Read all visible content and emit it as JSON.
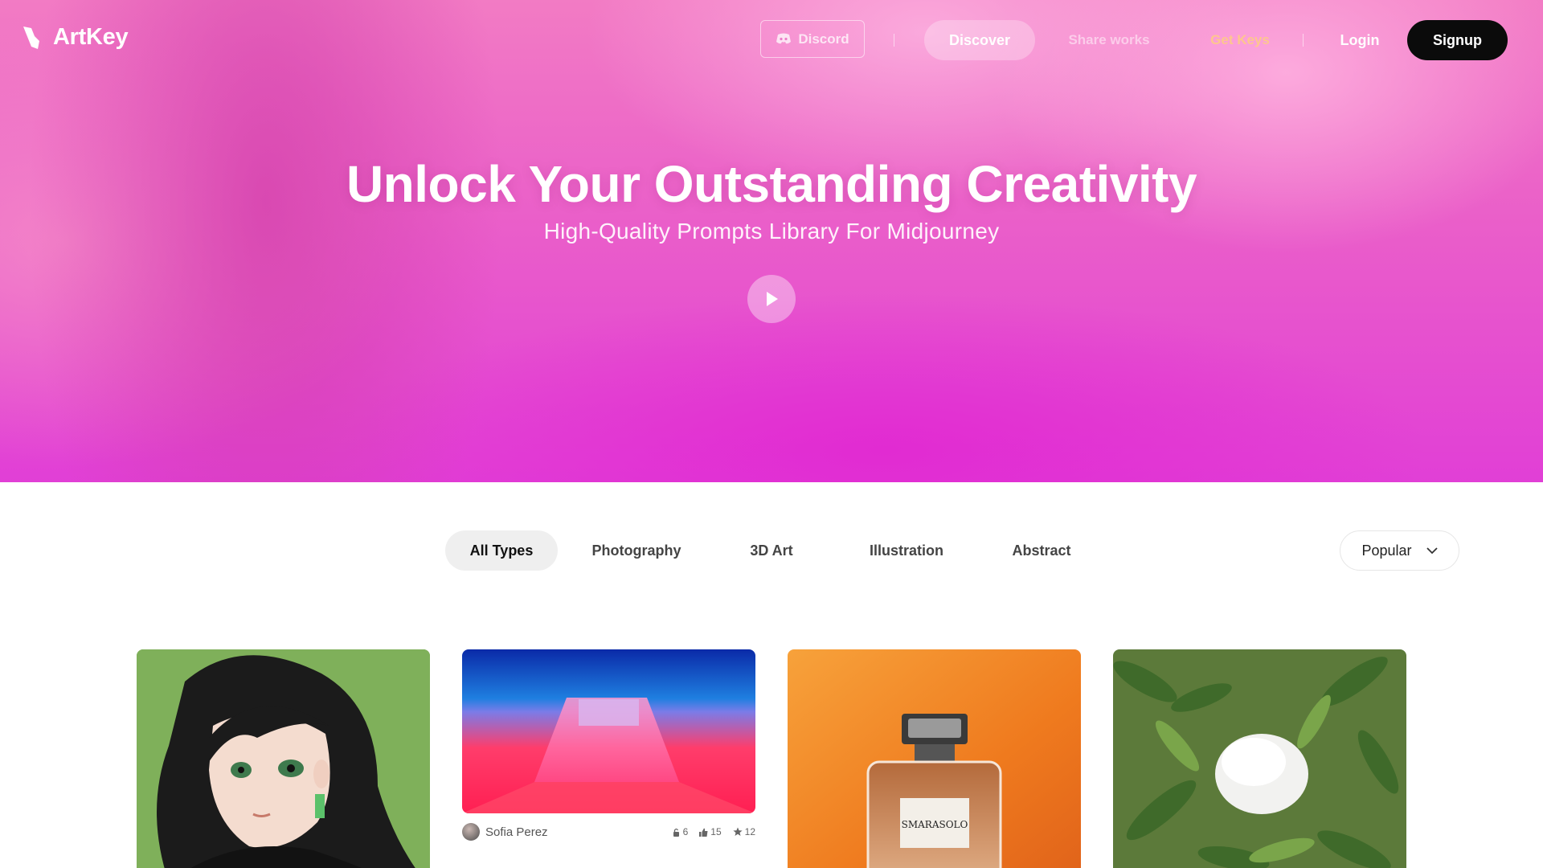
{
  "brand": {
    "name": "ArtKey"
  },
  "nav": {
    "discord_label": "Discord",
    "discover_label": "Discover",
    "share_label": "Share works",
    "keys_label": "Get Keys",
    "login_label": "Login",
    "signup_label": "Signup"
  },
  "hero": {
    "title": "Unlock Your Outstanding Creativity",
    "subtitle": "High-Quality Prompts Library For Midjourney"
  },
  "filters": {
    "tabs": [
      {
        "label": "All Types",
        "active": true
      },
      {
        "label": "Photography",
        "active": false
      },
      {
        "label": "3D Art",
        "active": false
      },
      {
        "label": "Illustration",
        "active": false
      },
      {
        "label": "Abstract",
        "active": false
      }
    ],
    "sort": "Popular"
  },
  "gallery": {
    "cards": [
      {
        "subject": "anime girl portrait"
      },
      {
        "subject": "neon pink corridor",
        "author": "Sofia Perez",
        "keys": "6",
        "likes": "15",
        "stars": "12"
      },
      {
        "subject": "perfume bottle",
        "label": "SMARASOLO"
      },
      {
        "subject": "white pebble device among leaves"
      }
    ]
  },
  "colors": {
    "hero_top": "#f27bc4",
    "hero_bottom": "#e13fd6",
    "signup_bg": "#0b0b0b",
    "keys_link": "#ffd76e"
  }
}
